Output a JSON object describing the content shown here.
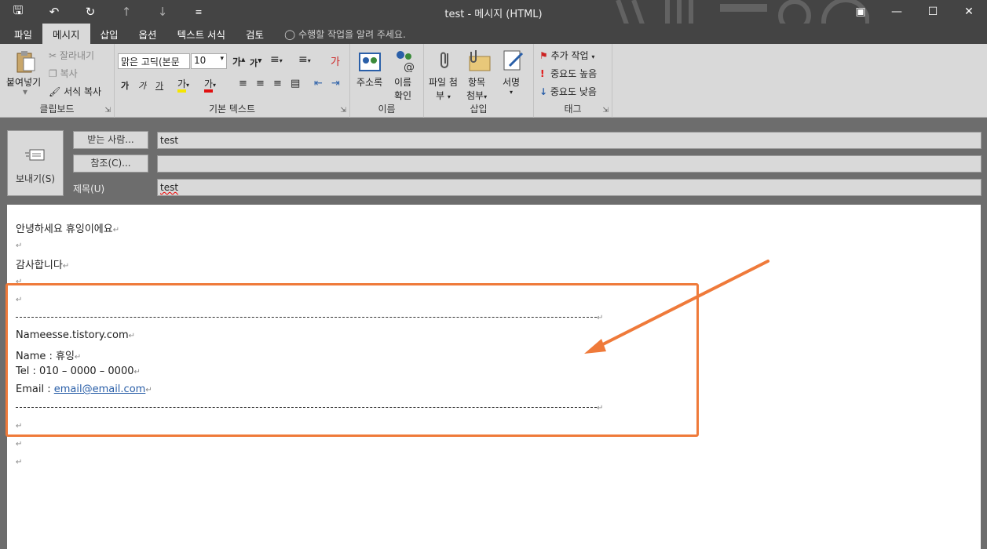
{
  "window": {
    "title": "test - 메시지 (HTML)",
    "qat": [
      "save-icon",
      "undo-icon",
      "redo-icon",
      "up-icon",
      "down-icon",
      "customize-icon"
    ]
  },
  "menu": {
    "tabs": [
      "파일",
      "메시지",
      "삽입",
      "옵션",
      "텍스트 서식",
      "검토"
    ],
    "active": "메시지",
    "tellme": "수행할 작업을 알려 주세요."
  },
  "ribbon": {
    "clipboard": {
      "label": "클립보드",
      "paste": "붙여넣기",
      "cut": "잘라내기",
      "copy": "복사",
      "format_painter": "서식 복사"
    },
    "basic_text": {
      "label": "기본 텍스트",
      "font": "맑은 고딕(본문",
      "size": "10"
    },
    "names": {
      "label": "이름",
      "address_book": "주소록",
      "check_names_1": "이름",
      "check_names_2": "확인"
    },
    "insert": {
      "label": "삽입",
      "attach_file_1": "파일 첨",
      "attach_file_2": "부",
      "attach_item_1": "항목",
      "attach_item_2": "첨부",
      "signature": "서명"
    },
    "tags": {
      "label": "태그",
      "follow_up": "추가 작업",
      "high_importance": "중요도 높음",
      "low_importance": "중요도 낮음"
    }
  },
  "compose": {
    "send": "보내기(S)",
    "to_button": "받는 사람...",
    "to_value": "test",
    "cc_button": "참조(C)...",
    "cc_value": "",
    "subject_label": "제목(U)",
    "subject_value": "test"
  },
  "body": {
    "greeting": "안녕하세요 휴잉이에요",
    "thanks": "감사합니다",
    "sig_site": "Nameesse.tistory.com",
    "sig_name": "Name : 휴잉",
    "sig_tel": "Tel : 010 – 0000 – 0000",
    "sig_email_label": "Email : ",
    "sig_email": "email@email.com",
    "para_mark": "↵"
  },
  "colors": {
    "annotation": "#ef7a3a",
    "titlebar": "#444444",
    "ribbon": "#d9d9d9"
  }
}
